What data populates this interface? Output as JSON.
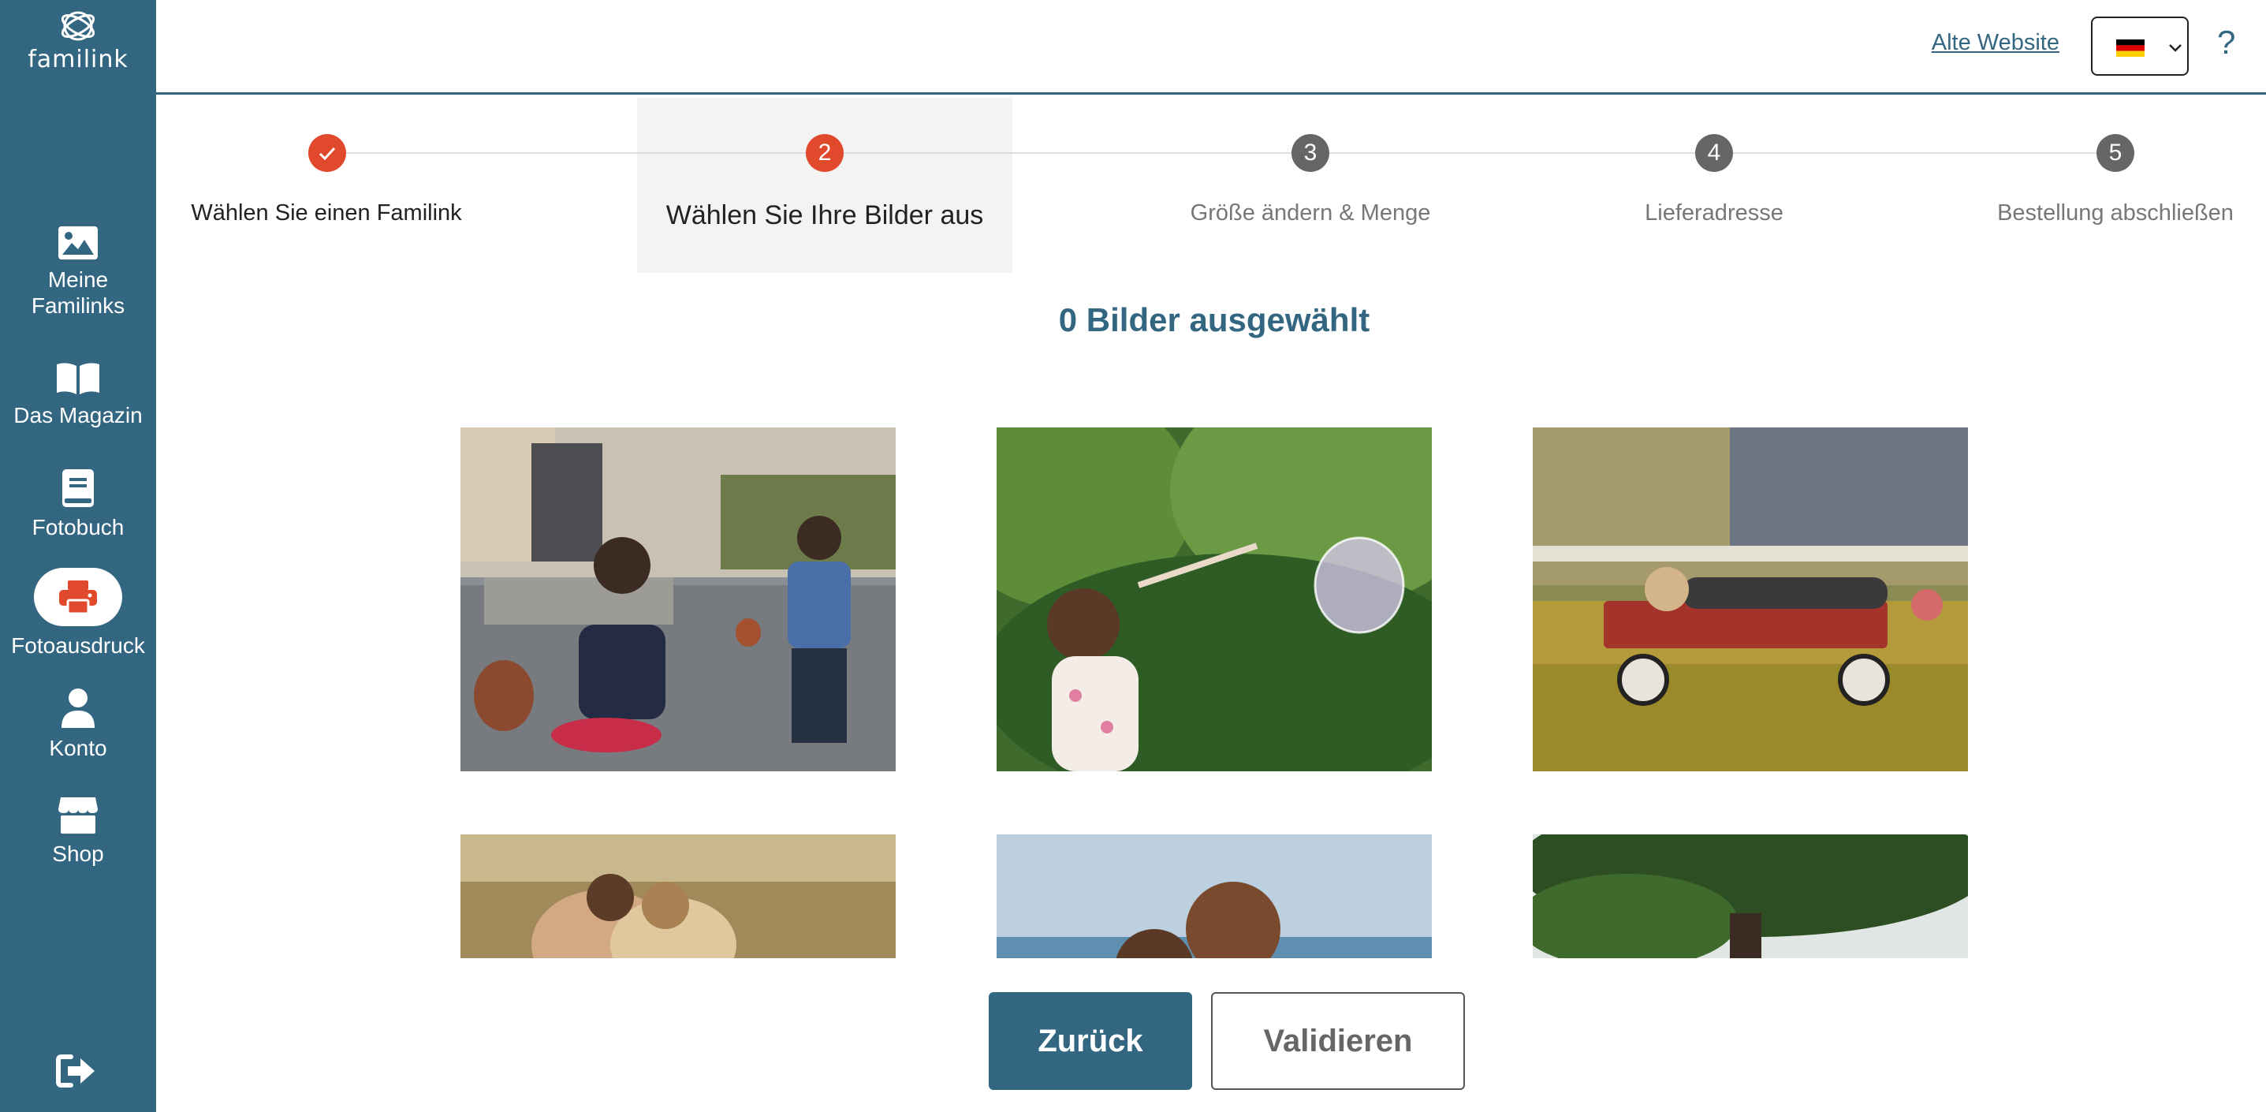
{
  "brand": {
    "name": "familink"
  },
  "sidebar": {
    "items": [
      {
        "label": "Meine\nFamilinks",
        "icon": "image-icon"
      },
      {
        "label": "Das Magazin",
        "icon": "book-open-icon"
      },
      {
        "label": "Fotobuch",
        "icon": "photo-book-icon"
      },
      {
        "label": "Fotoausdruck",
        "icon": "printer-icon",
        "active": true
      },
      {
        "label": "Konto",
        "icon": "user-icon"
      },
      {
        "label": "Shop",
        "icon": "store-icon"
      }
    ],
    "logout_icon": "logout-icon"
  },
  "header": {
    "old_site_link": "Alte Website",
    "language": {
      "selected": "de",
      "icon": "german-flag-icon"
    },
    "help": "?"
  },
  "stepper": {
    "steps": [
      {
        "number": "✓",
        "label": "Wählen Sie einen Familink",
        "state": "done"
      },
      {
        "number": "2",
        "label": "Wählen Sie Ihre Bilder aus",
        "state": "current"
      },
      {
        "number": "3",
        "label": "Größe ändern & Menge",
        "state": "todo"
      },
      {
        "number": "4",
        "label": "Lieferadresse",
        "state": "todo"
      },
      {
        "number": "5",
        "label": "Bestellung abschließen",
        "state": "todo"
      }
    ]
  },
  "main": {
    "selected_count": "0 Bilder ausgewählt",
    "photos": [
      {
        "name": "girls-bike-photo"
      },
      {
        "name": "girl-bubble-photo"
      },
      {
        "name": "children-wagon-photo"
      },
      {
        "name": "couple-field-photo"
      },
      {
        "name": "man-beach-photo"
      },
      {
        "name": "tree-photo"
      }
    ]
  },
  "actions": {
    "back_label": "Zurück",
    "validate_label": "Validieren"
  },
  "colors": {
    "primary": "#336680",
    "accent": "#e0492b",
    "muted_step": "#666666"
  }
}
